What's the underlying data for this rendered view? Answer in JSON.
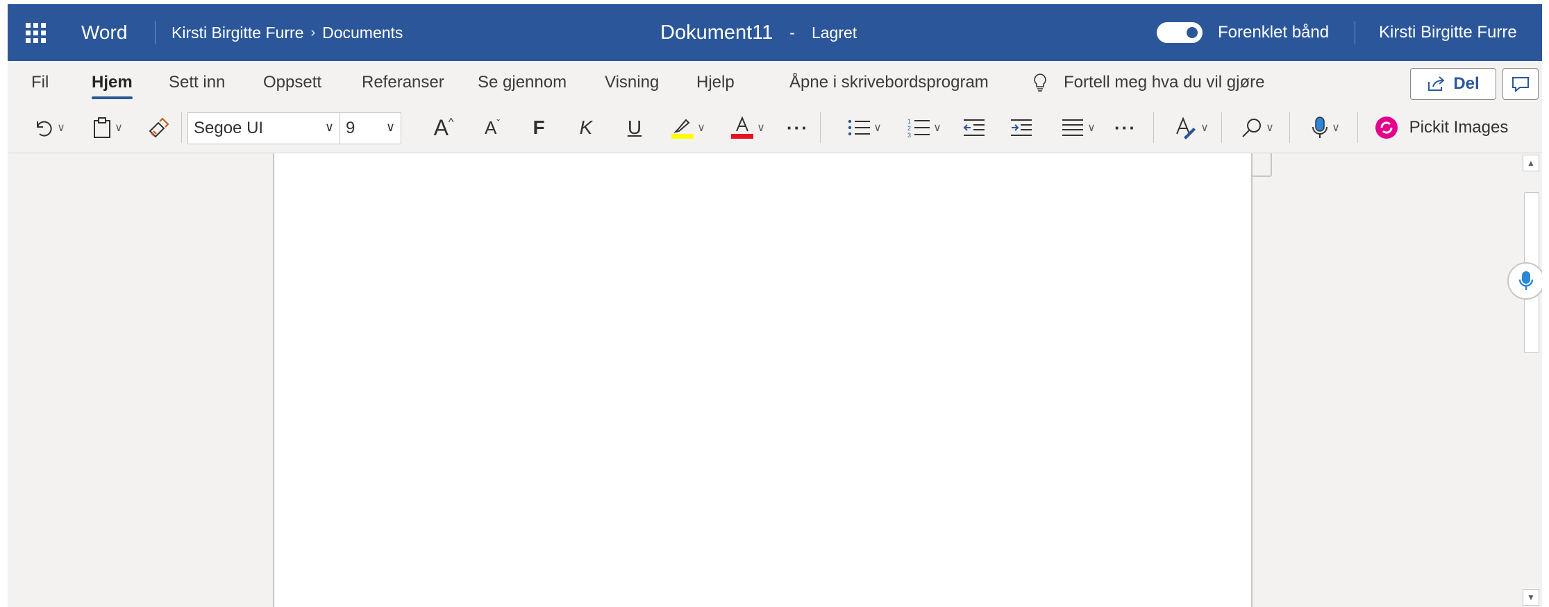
{
  "titlebar": {
    "app_name": "Word",
    "breadcrumb_owner": "Kirsti Birgitte Furre",
    "breadcrumb_folder": "Documents",
    "doc_name": "Dokument11",
    "separator": "-",
    "save_status": "Lagret",
    "toggle_label": "Forenklet bånd",
    "user_name": "Kirsti Birgitte Furre"
  },
  "ribbon": {
    "tabs": [
      {
        "label": "Fil"
      },
      {
        "label": "Hjem"
      },
      {
        "label": "Sett inn"
      },
      {
        "label": "Oppsett"
      },
      {
        "label": "Referanser"
      },
      {
        "label": "Se gjennom"
      },
      {
        "label": "Visning"
      },
      {
        "label": "Hjelp"
      },
      {
        "label": "Åpne i skrivebordsprogram"
      }
    ],
    "active_tab": "Hjem",
    "tell_me": "Fortell meg hva du vil gjøre",
    "share_label": "Del",
    "font_name": "Segoe UI",
    "font_size": "9",
    "bold_label": "F",
    "italic_label": "K",
    "underline_label": "U",
    "grow_font_label": "A",
    "shrink_font_label": "A",
    "highlight_color": "#ffff00",
    "font_color": "#e81123",
    "addin_label": "Pickit Images"
  },
  "colors": {
    "accent": "#2b579a",
    "ribbon_bg": "#f3f2f1",
    "pickit": "#e3008c",
    "dictate": "#2b88d8"
  },
  "icons": [
    "app-launcher-icon",
    "undo-icon",
    "paste-icon",
    "format-painter-icon",
    "lightbulb-icon",
    "share-icon",
    "comment-icon",
    "bullets-icon",
    "numbering-icon",
    "decrease-indent-icon",
    "increase-indent-icon",
    "align-icon",
    "more-icon",
    "styles-icon",
    "find-icon",
    "dictate-icon",
    "pickit-icon"
  ]
}
